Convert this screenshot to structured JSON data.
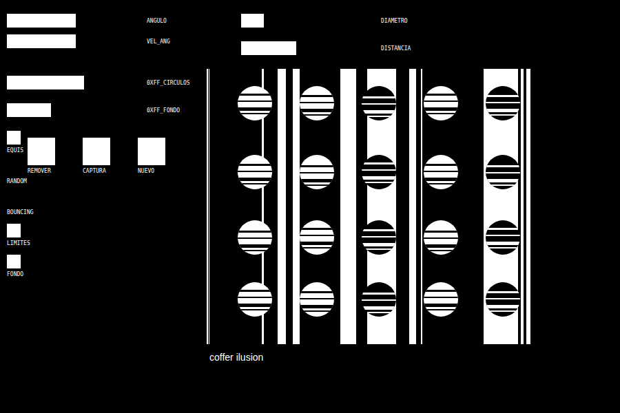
{
  "sliders": [
    {
      "label": "ANGULO",
      "level": 0.5
    },
    {
      "label": "VEL_ANG",
      "level": 0.5
    },
    {
      "label": "0XFF_CIRCULOS",
      "level": 0.56
    },
    {
      "label": "0XFF_FONDO",
      "level": 0.32
    },
    {
      "label": "DIAMETRO",
      "level": 0.165
    },
    {
      "label": "DISTANCIA",
      "level": 0.4
    }
  ],
  "toggles": [
    {
      "label": "EQUIS",
      "on": true
    },
    {
      "label": "RANDOM",
      "on": false
    },
    {
      "label": "BOUNCING",
      "on": false
    },
    {
      "label": "LIMITES",
      "on": true
    },
    {
      "label": "FONDO",
      "on": true
    }
  ],
  "buttons": [
    "REMOVER",
    "CAPTURA",
    "NUEVO"
  ],
  "canvas": {
    "caption": "coffer ilusion"
  }
}
